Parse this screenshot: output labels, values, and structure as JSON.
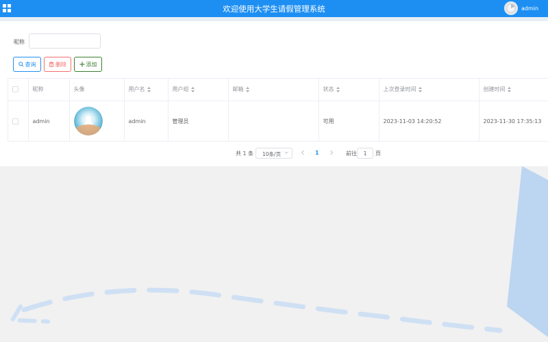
{
  "header": {
    "title": "欢迎使用大学生请假管理系统",
    "username": "admin",
    "bar_color": "#1d8ff3",
    "menu_icon": "grid-icon"
  },
  "search": {
    "label": "昵称",
    "value": "",
    "placeholder": ""
  },
  "toolbar": {
    "search_label": "查询",
    "delete_label": "删除",
    "add_label": "添加"
  },
  "table": {
    "columns": [
      "昵称",
      "头像",
      "用户名",
      "用户组",
      "邮箱",
      "状态",
      "上次登录时间",
      "创建时间"
    ],
    "rows": [
      {
        "nickname": "admin",
        "username": "admin",
        "group": "管理员",
        "email": "",
        "status": "可用",
        "last_login": "2023-11-03 14:20:52",
        "created": "2023-11-30 17:35:13"
      }
    ]
  },
  "pagination": {
    "total_label": "共 1 条",
    "page_size": "10条/页",
    "current_page": "1",
    "goto_label": "前往",
    "goto_value": "1",
    "page_suffix": "页"
  }
}
